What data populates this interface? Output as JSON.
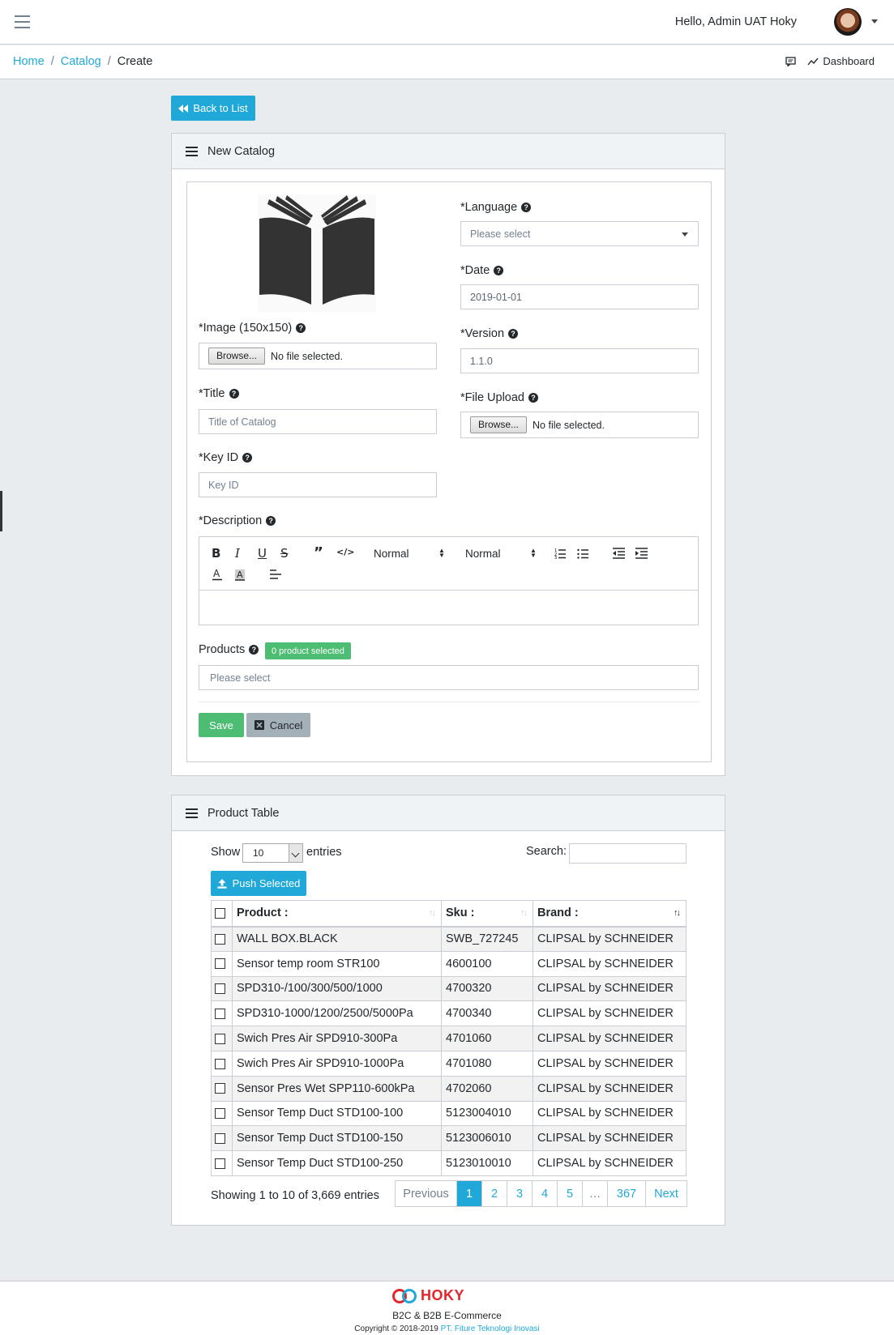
{
  "header": {
    "greeting": "Hello, Admin UAT Hoky"
  },
  "breadcrumb": {
    "home": "Home",
    "catalog": "Catalog",
    "current": "Create",
    "dashboard": "Dashboard"
  },
  "back_button": "Back to List",
  "form_card": {
    "title": "New Catalog",
    "image_label": "*Image (150x150)",
    "image_browse": "Browse...",
    "image_file_status": "No file selected.",
    "title_label": "*Title",
    "title_placeholder": "Title of Catalog",
    "keyid_label": "*Key ID",
    "keyid_placeholder": "Key ID",
    "language_label": "*Language",
    "language_value": "Please select",
    "date_label": "*Date",
    "date_value": "2019-01-01",
    "version_label": "*Version",
    "version_value": "1.1.0",
    "file_upload_label": "*File Upload",
    "file_browse": "Browse...",
    "file_status": "No file selected.",
    "description_label": "*Description",
    "editor": {
      "heading_select": "Normal",
      "size_select": "Normal"
    },
    "products_label": "Products",
    "products_badge": "0 product selected",
    "products_placeholder": "Please select",
    "save": "Save",
    "cancel": "Cancel"
  },
  "product_table": {
    "title": "Product Table",
    "show_label": "Show",
    "show_value": "10",
    "entries_label": "entries",
    "search_label": "Search:",
    "push_button": "Push Selected",
    "columns": [
      "Product :",
      "Sku :",
      "Brand :"
    ],
    "rows": [
      {
        "product": "WALL BOX.BLACK",
        "sku": "SWB_727245",
        "brand": "CLIPSAL by SCHNEIDER"
      },
      {
        "product": "Sensor temp room STR100",
        "sku": "4600100",
        "brand": "CLIPSAL by SCHNEIDER"
      },
      {
        "product": "SPD310-/100/300/500/1000",
        "sku": "4700320",
        "brand": "CLIPSAL by SCHNEIDER"
      },
      {
        "product": "SPD310-1000/1200/2500/5000Pa",
        "sku": "4700340",
        "brand": "CLIPSAL by SCHNEIDER"
      },
      {
        "product": "Swich Pres Air SPD910-300Pa",
        "sku": "4701060",
        "brand": "CLIPSAL by SCHNEIDER"
      },
      {
        "product": "Swich Pres Air SPD910-1000Pa",
        "sku": "4701080",
        "brand": "CLIPSAL by SCHNEIDER"
      },
      {
        "product": "Sensor Pres Wet SPP110-600kPa",
        "sku": "4702060",
        "brand": "CLIPSAL by SCHNEIDER"
      },
      {
        "product": "Sensor Temp Duct STD100-100",
        "sku": "5123004010",
        "brand": "CLIPSAL by SCHNEIDER"
      },
      {
        "product": "Sensor Temp Duct STD100-150",
        "sku": "5123006010",
        "brand": "CLIPSAL by SCHNEIDER"
      },
      {
        "product": "Sensor Temp Duct STD100-250",
        "sku": "5123010010",
        "brand": "CLIPSAL by SCHNEIDER"
      }
    ],
    "info": "Showing 1 to 10 of 3,669 entries",
    "pagination": {
      "previous": "Previous",
      "pages": [
        "1",
        "2",
        "3",
        "4",
        "5"
      ],
      "ellipsis": "…",
      "last": "367",
      "next": "Next",
      "current": "1"
    }
  },
  "footer": {
    "brand": "HOKY",
    "tagline": "B2C & B2B E-Commerce",
    "copyright": "Copyright © 2018-2019",
    "company": "PT. Fiture Teknologi Inovasi"
  },
  "colors": {
    "primary": "#20a8d8",
    "success": "#4dbd74",
    "brand_red": "#e1262d"
  }
}
